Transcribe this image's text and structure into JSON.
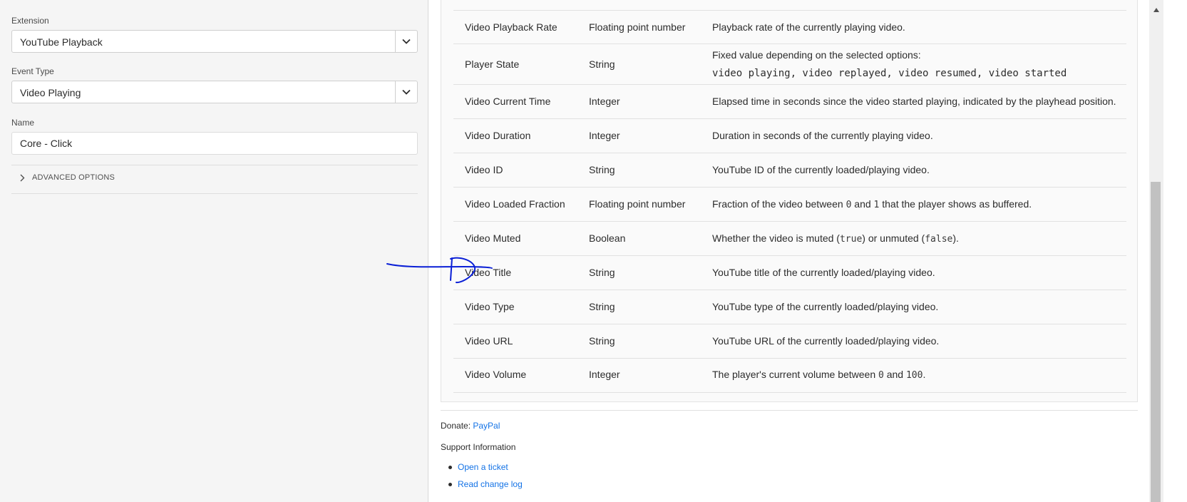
{
  "left_panel": {
    "extension": {
      "label": "Extension",
      "value": "YouTube Playback"
    },
    "event_type": {
      "label": "Event Type",
      "value": "Video Playing"
    },
    "name": {
      "label": "Name",
      "value": "Core - Click"
    },
    "advanced_options": "ADVANCED OPTIONS"
  },
  "table": {
    "rows": [
      {
        "name": "Video Playback Rate",
        "type": "Floating point number",
        "desc": "Playback rate of the currently playing video."
      },
      {
        "name": "Player State",
        "type": "String",
        "desc": "Fixed value depending on the selected options:",
        "desc_code": "video playing, video replayed, video resumed, video started"
      },
      {
        "name": "Video Current Time",
        "type": "Integer",
        "desc": "Elapsed time in seconds since the video started playing, indicated by the playhead position."
      },
      {
        "name": "Video Duration",
        "type": "Integer",
        "desc": "Duration in seconds of the currently playing video."
      },
      {
        "name": "Video ID",
        "type": "String",
        "desc": "YouTube ID of the currently loaded/playing video."
      },
      {
        "name": "Video Loaded Fraction",
        "type": "Floating point number",
        "desc_parts": [
          "Fraction of the video between ",
          "0",
          " and ",
          "1",
          " that the player shows as buffered."
        ]
      },
      {
        "name": "Video Muted",
        "type": "Boolean",
        "desc_parts": [
          "Whether the video is muted (",
          "true",
          ") or unmuted (",
          "false",
          ")."
        ]
      },
      {
        "name": "Video Title",
        "type": "String",
        "desc": "YouTube title of the currently loaded/playing video."
      },
      {
        "name": "Video Type",
        "type": "String",
        "desc": "YouTube type of the currently loaded/playing video."
      },
      {
        "name": "Video URL",
        "type": "String",
        "desc": "YouTube URL of the currently loaded/playing video."
      },
      {
        "name": "Video Volume",
        "type": "Integer",
        "desc_parts": [
          "The player's current volume between ",
          "0",
          " and ",
          "100",
          "."
        ]
      }
    ]
  },
  "footer": {
    "donate_label": "Donate:",
    "donate_link": "PayPal",
    "support_heading": "Support Information",
    "links": [
      "Open a ticket",
      "Read change log"
    ]
  },
  "colors": {
    "link": "#1473e6",
    "annotation": "#0a1fd6"
  },
  "icons": {
    "dropdown": "chevron-down-icon",
    "expand": "chevron-right-icon",
    "scroll_up": "triangle-up-icon"
  }
}
